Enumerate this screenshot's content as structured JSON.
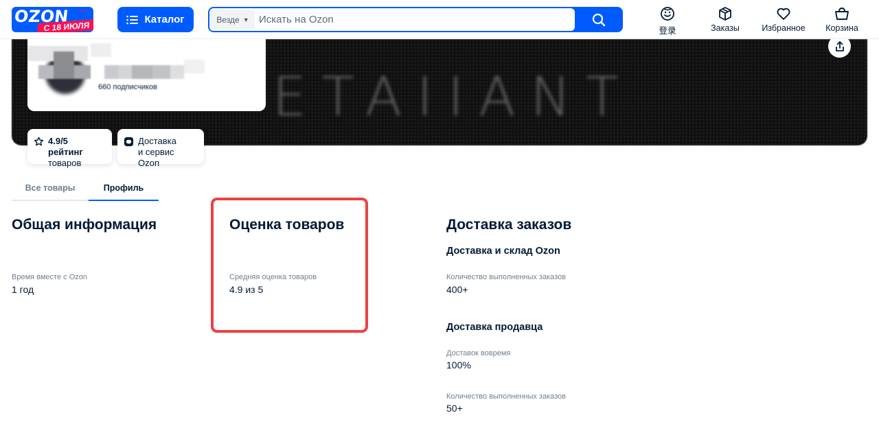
{
  "header": {
    "logo": {
      "word": "OZON",
      "promo": "С 18 ИЮЛЯ",
      "brand_color": "#005bff",
      "promo_color": "#f91155"
    },
    "catalog_label": "Каталог",
    "search": {
      "scope": "Везде",
      "placeholder": "Искать на Ozon"
    },
    "nav": {
      "login": {
        "label": "登录",
        "icon": "smile-icon"
      },
      "orders": {
        "label": "Заказы",
        "icon": "box-icon"
      },
      "favorites": {
        "label": "Избранное",
        "icon": "heart-icon"
      },
      "cart": {
        "label": "Корзина",
        "icon": "basket-icon"
      }
    }
  },
  "banner": {
    "text": "ETAIIANT",
    "seller_followers": "660 подписчиков"
  },
  "badges": {
    "rating": {
      "value": "4.9/5",
      "text1": "рейтинг",
      "text2": "товаров",
      "icon": "star-icon"
    },
    "delivery": {
      "line1": "Доставка",
      "line2": "и сервис Ozon",
      "icon": "ozon-box-icon"
    }
  },
  "tabs": {
    "all": "Все товары",
    "profile": "Профиль",
    "active": "profile"
  },
  "general": {
    "title": "Общая информация",
    "time_label": "Время вместе с Ozon",
    "time_value": "1 год"
  },
  "rating_section": {
    "title": "Оценка товаров",
    "avg_label": "Средняя оценка товаров",
    "avg_value": "4.9 из 5",
    "highlight_color": "#ee4141"
  },
  "delivery_section": {
    "title": "Доставка заказов",
    "ozon": {
      "subtitle": "Доставка и склад Ozon",
      "orders_label": "Количество выполненных заказов",
      "orders_value": "400+"
    },
    "seller": {
      "subtitle": "Доставка продавца",
      "ontime_label": "Доставок вовремя",
      "ontime_value": "100%",
      "orders_label": "Количество выполненных заказов",
      "orders_value": "50+"
    }
  }
}
